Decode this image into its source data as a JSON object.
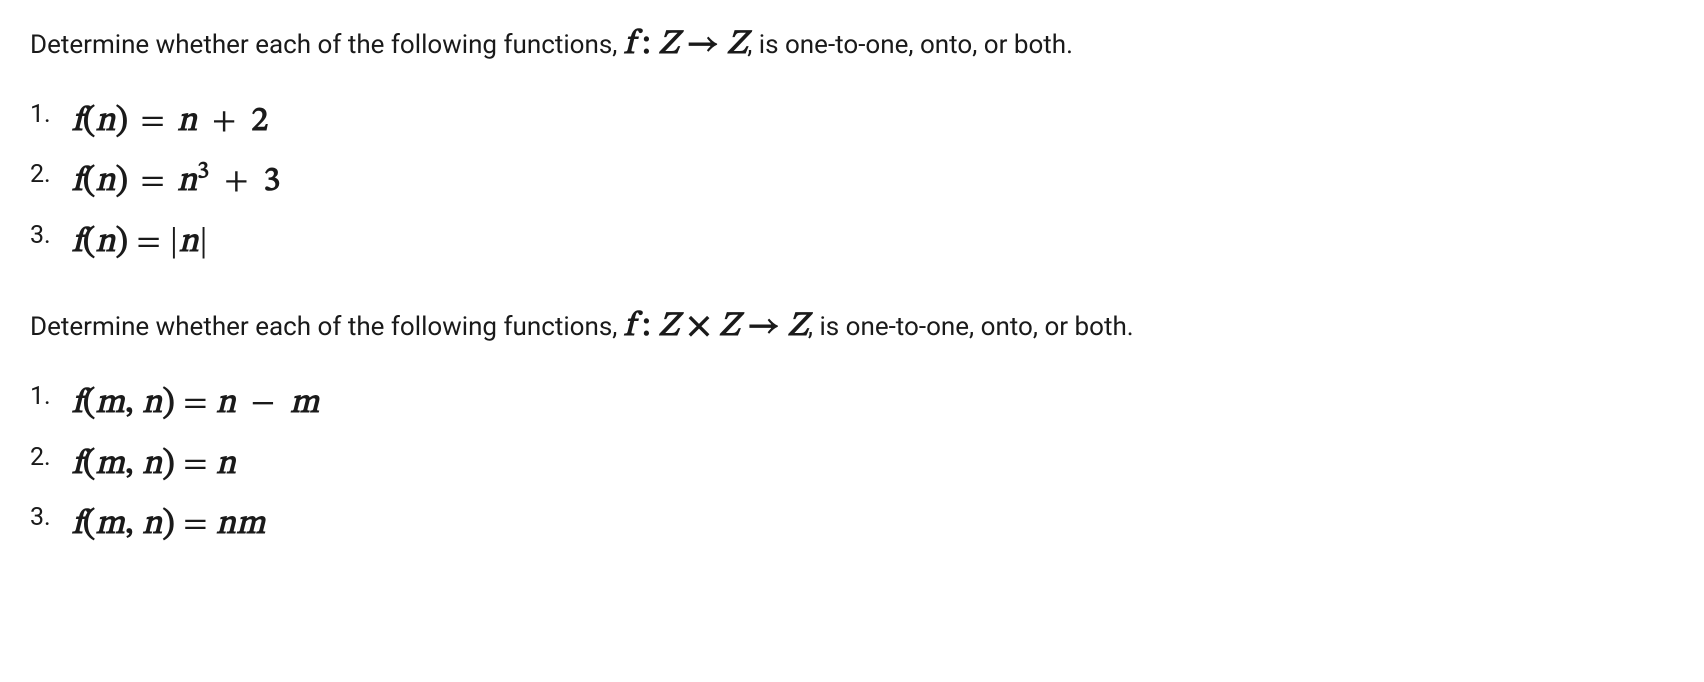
{
  "section1": {
    "prompt_pre": "Determine whether each of the following functions, ",
    "prompt_post": ", is one-to-one, onto, or both.",
    "mapping_f": "f",
    "mapping_colon": " : ",
    "mapping_dom": "Z",
    "mapping_arrow": " → ",
    "mapping_cod": "Z",
    "items": [
      {
        "num": "1.",
        "lhs_f": "f",
        "lhs_paren_open": "(",
        "var": "n",
        "lhs_paren_close": ")",
        "rhs": "n",
        "tail_op": " + ",
        "tail_num": "2"
      },
      {
        "num": "2.",
        "lhs_f": "f",
        "lhs_paren_open": "(",
        "var": "n",
        "lhs_paren_close": ")",
        "rhs": "n",
        "sup": "3",
        "tail_op": " + ",
        "tail_num": "3"
      },
      {
        "num": "3.",
        "lhs_f": "f",
        "lhs_paren_open": "(",
        "var": "n",
        "lhs_paren_close": ")",
        "abs_open": "|",
        "rhs": "n",
        "abs_close": "|"
      }
    ]
  },
  "section2": {
    "prompt_pre": "Determine whether each of the following functions, ",
    "prompt_post": ", is one-to-one, onto, or both.",
    "mapping_f": "f",
    "mapping_colon": " : ",
    "mapping_dom1": "Z",
    "mapping_times": " × ",
    "mapping_dom2": "Z",
    "mapping_arrow": " → ",
    "mapping_cod": "Z",
    "items": [
      {
        "num": "1.",
        "lhs_f": "f",
        "lhs_paren_open": "(",
        "var1": "m",
        "comma": ", ",
        "var2": "n",
        "lhs_paren_close": ")",
        "rhs1": "n",
        "mid_op": " − ",
        "rhs2": "m"
      },
      {
        "num": "2.",
        "lhs_f": "f",
        "lhs_paren_open": "(",
        "var1": "m",
        "comma": ", ",
        "var2": "n",
        "lhs_paren_close": ")",
        "rhs1": "n"
      },
      {
        "num": "3.",
        "lhs_f": "f",
        "lhs_paren_open": "(",
        "var1": "m",
        "comma": ", ",
        "var2": "n",
        "lhs_paren_close": ")",
        "rhs1": "n",
        "rhs2": "m"
      }
    ]
  }
}
